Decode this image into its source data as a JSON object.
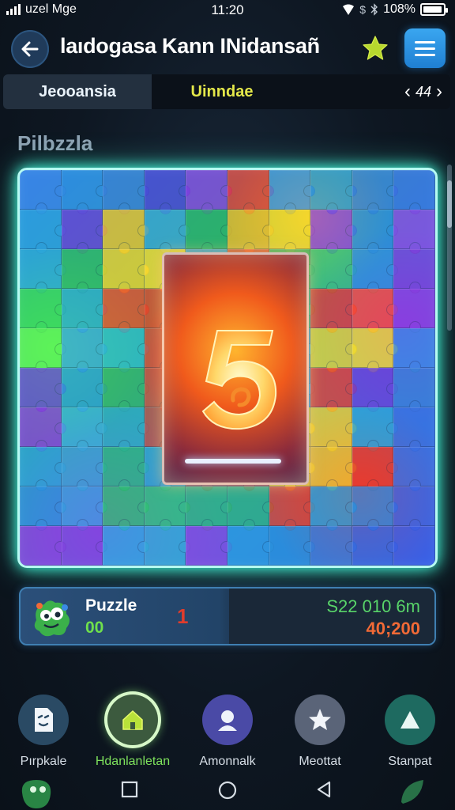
{
  "status_bar": {
    "carrier": "uzel Mge",
    "time": "11:20",
    "battery_text": "108%",
    "battery_level": 0.95
  },
  "header": {
    "title": "laıdogasa Kann INidansañ",
    "back_icon": "back-arrow-icon",
    "favorite_icon": "star-icon",
    "menu_icon": "hamburger-menu-icon"
  },
  "tabs": {
    "items": [
      "Jeooansia",
      "Uinndae"
    ],
    "active_index": 0,
    "page_number": "44"
  },
  "section": {
    "title": "Pilbzzla"
  },
  "board": {
    "columns": 10,
    "rows": 10,
    "piece_colors": [
      "#3b83e6",
      "#2f8ce0",
      "#3a7ed8",
      "#4d3fd8",
      "#8a3ee0",
      "#e6373a",
      "#3d8be6",
      "#2c93d8",
      "#3a7bd9",
      "#3b6ee4",
      "#2c9fe0",
      "#6a3fd8",
      "#f2c12a",
      "#3aa5d6",
      "#2ab06c",
      "#f0b82a",
      "#f3d42a",
      "#8a3ee0",
      "#2d88dc",
      "#8f44e2",
      "#2da9d8",
      "#2fb964",
      "#f5d12a",
      "#ffdb2c",
      "#3a9edc",
      "#ea4a2e",
      "#2fae5e",
      "#37c07a",
      "#2e8fdc",
      "#7a3fd9",
      "#37d460",
      "#2ca8d0",
      "#ee4a2c",
      "#e6432a",
      "#f0782a",
      "#ff8a2c",
      "#2bb27a",
      "#e33b2d",
      "#ff4a34",
      "#8a3ee0",
      "#5ef05a",
      "#3aa5e0",
      "#2fb8d0",
      "#d84a3a",
      "#ff9a2e",
      "#ff9a2e",
      "#2ba5d6",
      "#e8d82a",
      "#f7df2a",
      "#3a8ae6",
      "#6a45d8",
      "#2a9adc",
      "#33b070",
      "#d04a3e",
      "#ffa030",
      "#ff8a2e",
      "#2e9ae2",
      "#ea3a2c",
      "#6a3fd8",
      "#3a7ed8",
      "#8a3ee0",
      "#3aaee0",
      "#2ea8c8",
      "#c04a48",
      "#d45a3a",
      "#e06a34",
      "#ecd42a",
      "#f5d02a",
      "#2ba6da",
      "#3a6fe2",
      "#2ba0e0",
      "#3aa0d8",
      "#2ab680",
      "#2ca4d0",
      "#8a4a6a",
      "#9a3a5a",
      "#f3d22a",
      "#f1c72a",
      "#e63a2c",
      "#3a6ee4",
      "#2c8fe0",
      "#3b9ce0",
      "#2fbd70",
      "#31c276",
      "#33b27a",
      "#30b07c",
      "#e0402c",
      "#2aa0d8",
      "#2b8ae0",
      "#3b64e4",
      "#8a3ee0",
      "#7e44de",
      "#2fa5e0",
      "#34a8d6",
      "#8a42e0",
      "#2d96e0",
      "#2a8edc",
      "#3a7ad8",
      "#3368e4",
      "#3b5ee6"
    ],
    "center_card_glyph": "5"
  },
  "score_panel": {
    "label": "Puzzle",
    "value": "00",
    "middle_value": "1",
    "time_text": "S22 010 6m",
    "score_text": "40;200",
    "mascot_icon": "monster-mascot-icon"
  },
  "bottom_nav": {
    "items": [
      {
        "label": "Pırpkale",
        "icon": "document-icon",
        "color": "#2a4a64"
      },
      {
        "label": "Hdanlanletan",
        "icon": "house-icon",
        "color": "#3c5a3e"
      },
      {
        "label": "Amonnalk",
        "icon": "person-icon",
        "color": "#4a4aa6"
      },
      {
        "label": "Meottat",
        "icon": "star-icon",
        "color": "#5a6478"
      },
      {
        "label": "Stanpat",
        "icon": "triangle-icon",
        "color": "#1e6a60"
      }
    ],
    "active_index": 1
  },
  "colors": {
    "accent_blue": "#2a90e0",
    "accent_green": "#6fe04c",
    "board_glow": "#44ffe0",
    "tab_active_text": "#e4e84a"
  }
}
